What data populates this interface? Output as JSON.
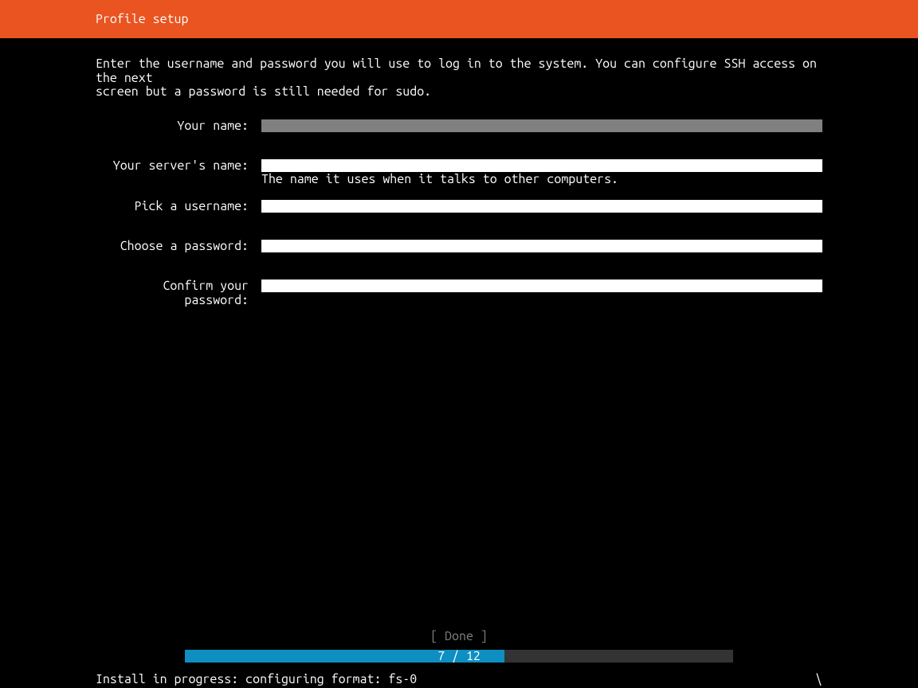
{
  "header": {
    "title": "Profile setup"
  },
  "description": "Enter the username and password you will use to log in to the system. You can configure SSH access on the next\nscreen but a password is still needed for sudo.",
  "form": {
    "name": {
      "label": "Your name:",
      "value": ""
    },
    "server_name": {
      "label": "Your server's name:",
      "value": "",
      "help": "The name it uses when it talks to other computers."
    },
    "username": {
      "label": "Pick a username:",
      "value": ""
    },
    "password": {
      "label": "Choose a password:",
      "value": ""
    },
    "confirm_password": {
      "label": "Confirm your password:",
      "value": ""
    }
  },
  "done_button": "[ Done       ]",
  "progress": {
    "current": 7,
    "total": 12,
    "text": "7 / 12",
    "percent": 58.3
  },
  "status": {
    "text": "Install in progress: configuring format: fs-0",
    "spinner": "\\"
  }
}
